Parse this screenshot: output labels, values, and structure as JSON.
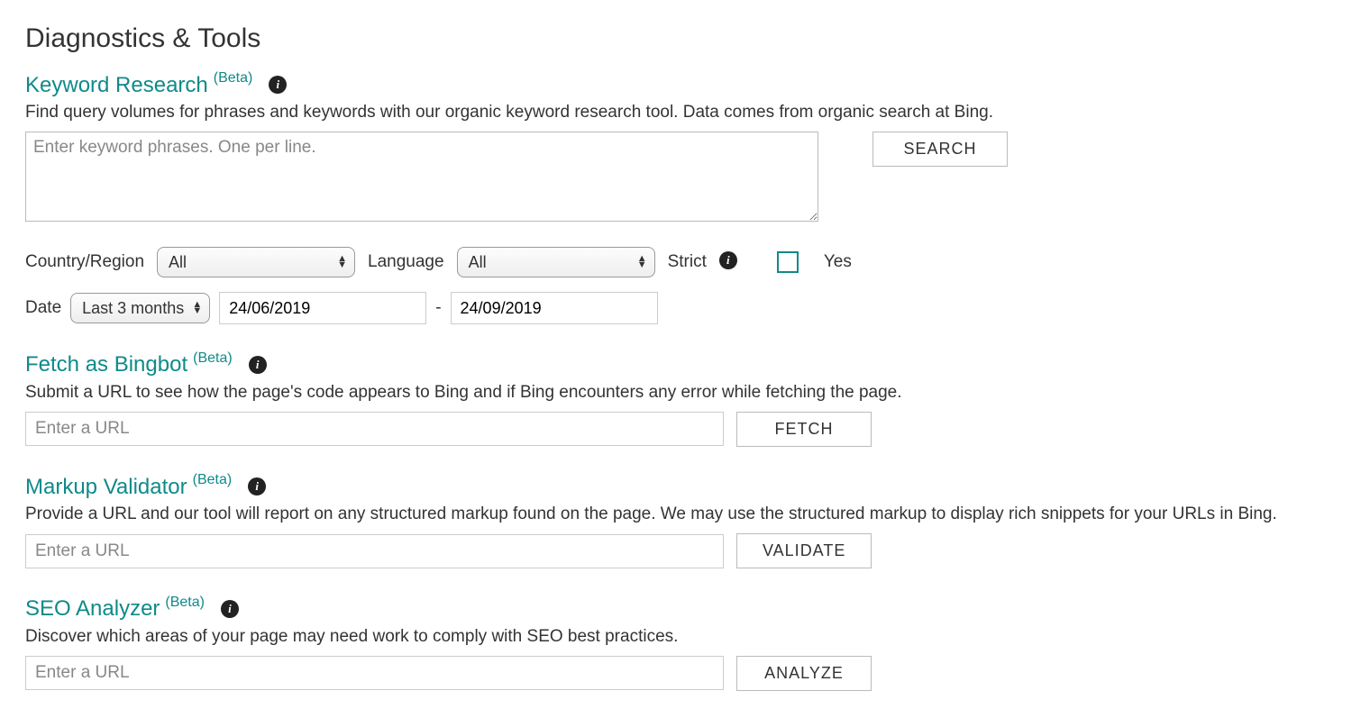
{
  "page": {
    "title": "Diagnostics & Tools"
  },
  "common": {
    "beta": "(Beta)"
  },
  "keyword": {
    "title": "Keyword Research",
    "desc": "Find query volumes for phrases and keywords with our organic keyword research tool. Data comes from organic search at Bing.",
    "placeholder": "Enter keyword phrases. One per line.",
    "search_label": "SEARCH",
    "country_label": "Country/Region",
    "country_value": "All",
    "language_label": "Language",
    "language_value": "All",
    "strict_label": "Strict",
    "yes_label": "Yes",
    "date_label": "Date",
    "date_range_value": "Last 3 months",
    "date_from": "24/06/2019",
    "date_to": "24/09/2019",
    "date_dash": "-"
  },
  "fetch": {
    "title": "Fetch as Bingbot",
    "desc": "Submit a URL to see how the page's code appears to Bing and if Bing encounters any error while fetching the page.",
    "placeholder": "Enter a URL",
    "button": "FETCH"
  },
  "markup": {
    "title": "Markup Validator",
    "desc": "Provide a URL and our tool will report on any structured markup found on the page. We may use the structured markup to display rich snippets for your URLs in Bing.",
    "placeholder": "Enter a URL",
    "button": "VALIDATE"
  },
  "seo": {
    "title": "SEO Analyzer",
    "desc": "Discover which areas of your page may need work to comply with SEO best practices.",
    "placeholder": "Enter a URL",
    "button": "ANALYZE"
  }
}
